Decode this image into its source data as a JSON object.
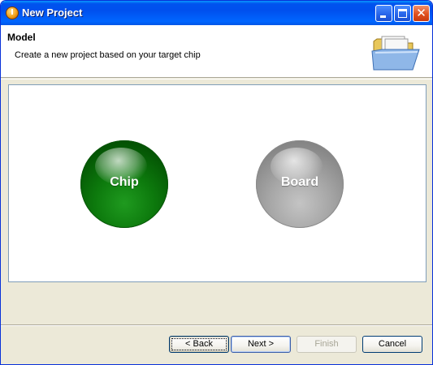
{
  "window": {
    "title": "New Project",
    "app_icon_glyph": "I"
  },
  "header": {
    "title": "Model",
    "description": "Create a new project based on your target chip"
  },
  "options": [
    {
      "label": "Chip",
      "color": "#0d7a0d"
    },
    {
      "label": "Board",
      "color": "#a6a6a6"
    }
  ],
  "buttons": {
    "back": "< Back",
    "next": "Next >",
    "finish": "Finish",
    "cancel": "Cancel"
  },
  "icons": {
    "header_image": "open-folder-icon",
    "minimize": "minimize-icon",
    "maximize": "maximize-icon",
    "close": "close-icon"
  },
  "colors": {
    "titlebar": "#0054e3",
    "dialog_bg": "#ece9d8",
    "chip_ball": "#0d7a0d",
    "board_ball": "#a6a6a6"
  }
}
